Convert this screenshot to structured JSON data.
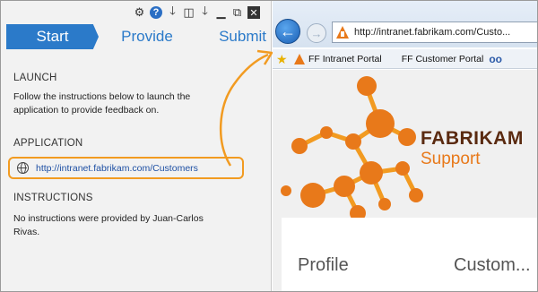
{
  "toolbar": {
    "icons": [
      "gear-icon",
      "help-icon",
      "down-icon",
      "panel-icon",
      "down-icon",
      "minimize-icon",
      "restore-icon",
      "close-icon"
    ]
  },
  "tabs": {
    "start": "Start",
    "provide": "Provide",
    "submit": "Submit"
  },
  "launch": {
    "title": "LAUNCH",
    "text": "Follow the instructions below to launch the application to provide feedback on."
  },
  "application": {
    "title": "APPLICATION",
    "url": "http://intranet.fabrikam.com/Customers"
  },
  "instructions": {
    "title": "INSTRUCTIONS",
    "text": "No instructions were provided by Juan-Carlos Rivas."
  },
  "browser": {
    "address": "http://intranet.fabrikam.com/Custo...",
    "favorites": [
      {
        "label": "FF Intranet Portal"
      },
      {
        "label": "FF Customer Portal"
      }
    ]
  },
  "site": {
    "brand": "FABRIKAM",
    "brand_sub": "Support",
    "nav_profile": "Profile",
    "nav_customers": "Custom..."
  },
  "colors": {
    "accent": "#2b7ac9",
    "highlight": "#f29b21",
    "brand_orange": "#e8791a"
  }
}
